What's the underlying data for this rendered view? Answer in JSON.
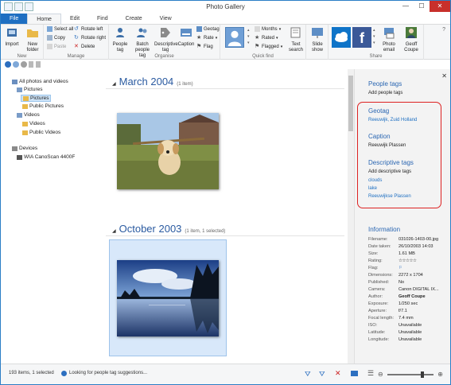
{
  "window": {
    "title": "Photo Gallery"
  },
  "tabs": [
    "File",
    "Home",
    "Edit",
    "Find",
    "Create",
    "View"
  ],
  "ribbon": {
    "new": {
      "label": "New",
      "import": "Import",
      "new_folder": "New folder"
    },
    "manage": {
      "label": "Manage",
      "select_all": "Select all",
      "copy": "Copy",
      "paste": "Paste",
      "rotate_left": "Rotate left",
      "rotate_right": "Rotate right",
      "delete": "Delete"
    },
    "organise": {
      "label": "Organise",
      "people_tag": "People tag",
      "batch_people_tag": "Batch people tag",
      "descriptive_tag": "Descriptive tag",
      "caption": "Caption",
      "geotag": "Geotag",
      "rate": "Rate",
      "flag": "Flag"
    },
    "quick_find": {
      "label": "Quick find",
      "months": "Months",
      "rated": "Rated",
      "flagged": "Flagged",
      "text_search": "Text search"
    },
    "slide_show": "Slide show",
    "share": {
      "label": "Share",
      "photo_email": "Photo email",
      "geoff_coupe": "Geoff Coupe"
    }
  },
  "tree": {
    "all_photos": "All photos and videos",
    "pictures": "Pictures",
    "pictures_child": "Pictures",
    "public_pictures": "Public Pictures",
    "videos": "Videos",
    "videos_child": "Videos",
    "public_videos": "Public Videos",
    "devices": "Devices",
    "scanner": "WIA CanoScan 4400F"
  },
  "gallery": {
    "sections": [
      {
        "date": "March 2004",
        "count": "(1 item)"
      },
      {
        "date": "October 2003",
        "count": "(1 item, 1 selected)"
      }
    ]
  },
  "panel": {
    "people_tags": {
      "heading": "People tags",
      "add": "Add people tags"
    },
    "geotag": {
      "heading": "Geotag",
      "value": "Reeuwijk, Zuid Holland"
    },
    "caption": {
      "heading": "Caption",
      "value": "Reeuwijk Plassen"
    },
    "descriptive_tags": {
      "heading": "Descriptive tags",
      "add": "Add descriptive tags",
      "tags": [
        "clouds",
        "lake",
        "Reeuwijkse Plassen"
      ]
    },
    "information": {
      "heading": "Information",
      "rows": [
        {
          "k": "Filename:",
          "v": "031026-1403-00.jpg"
        },
        {
          "k": "Date taken:",
          "v": "26/10/2003  14:03"
        },
        {
          "k": "Size:",
          "v": "1.61 MB"
        },
        {
          "k": "Rating:",
          "v": "☆☆☆☆☆"
        },
        {
          "k": "Flag:",
          "v": "⚐"
        },
        {
          "k": "Dimensions:",
          "v": "2272 x 1704"
        },
        {
          "k": "Published:",
          "v": "No"
        },
        {
          "k": "Camera:",
          "v": "Canon DIGITAL IX..."
        },
        {
          "k": "Author:",
          "v": "Geoff Coupe"
        },
        {
          "k": "Exposure:",
          "v": "1/250 sec"
        },
        {
          "k": "Aperture:",
          "v": "f/7.1"
        },
        {
          "k": "Focal length:",
          "v": "7.4 mm"
        },
        {
          "k": "ISO:",
          "v": "Unavailable"
        },
        {
          "k": "Latitude:",
          "v": "Unavailable"
        },
        {
          "k": "Longitude:",
          "v": "Unavailable"
        }
      ]
    }
  },
  "status": {
    "count": "193 items, 1 selected",
    "message": "Looking for people tag suggestions..."
  },
  "zoom": {
    "level": 0.75
  },
  "colors": {
    "accent": "#1e6fc2",
    "heading": "#2a66b2",
    "highlight": "#dd2222"
  }
}
